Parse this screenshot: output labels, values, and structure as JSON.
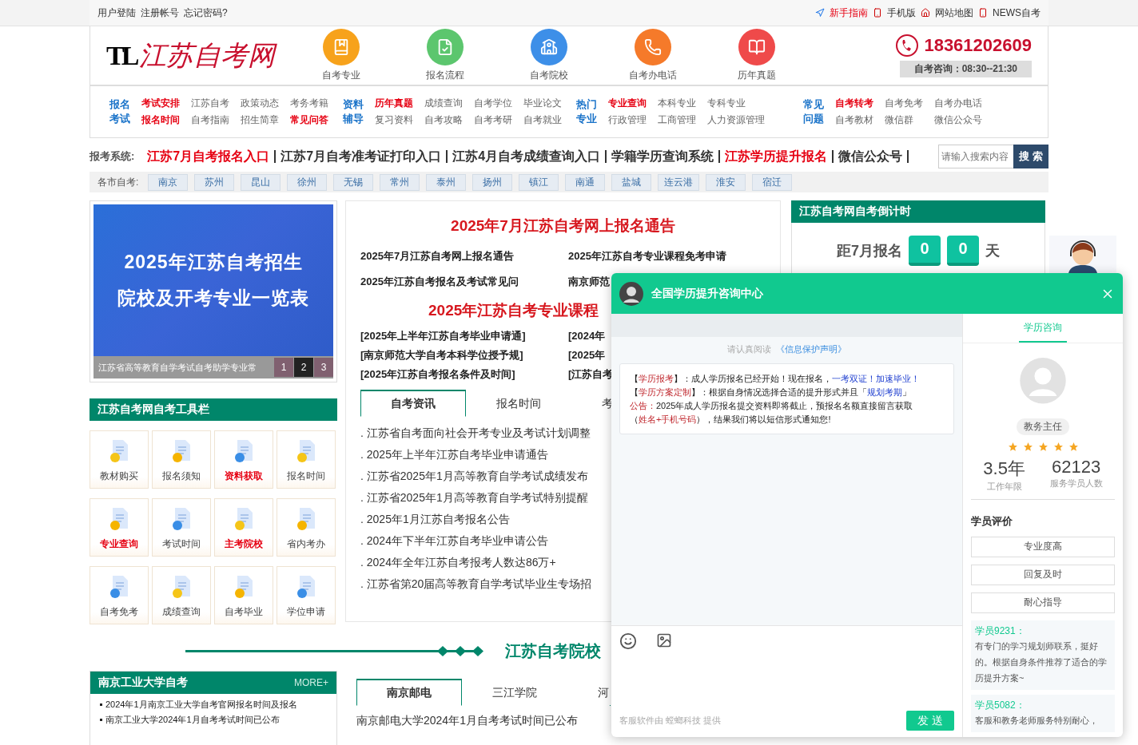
{
  "top_bar": {
    "left_links": [
      "用户登陆",
      "注册帐号",
      "忘记密码?"
    ],
    "right_links": [
      {
        "label": "新手指南",
        "highlighted": true
      },
      {
        "label": "手机版",
        "highlighted": false
      },
      {
        "label": "网站地图",
        "highlighted": false
      },
      {
        "label": "NEWS自考",
        "highlighted": false
      }
    ]
  },
  "header": {
    "logo_mark": "TL",
    "logo_text": "江苏自考网",
    "nav_icons": [
      {
        "label": "自考专业",
        "color": "#f7a21b"
      },
      {
        "label": "报名流程",
        "color": "#5cc66e"
      },
      {
        "label": "自考院校",
        "color": "#3d8fe8"
      },
      {
        "label": "自考办电话",
        "color": "#f57a2a"
      },
      {
        "label": "历年真题",
        "color": "#ef4a4a"
      }
    ],
    "phone": "18361202609",
    "hours": "自考咨询：08:30--21:30"
  },
  "nav_groups": [
    {
      "title_lines": [
        "报名",
        "考试"
      ],
      "rows": [
        [
          {
            "label": "考试安排",
            "highlighted": true
          },
          {
            "label": "江苏自考",
            "highlighted": false
          },
          {
            "label": "政策动态",
            "highlighted": false
          },
          {
            "label": "考务考籍",
            "highlighted": false
          }
        ],
        [
          {
            "label": "报名时间",
            "highlighted": true
          },
          {
            "label": "自考指南",
            "highlighted": false
          },
          {
            "label": "招生简章",
            "highlighted": false
          },
          {
            "label": "常见问答",
            "highlighted": true
          }
        ]
      ]
    },
    {
      "title_lines": [
        "资料",
        "辅导"
      ],
      "rows": [
        [
          {
            "label": "历年真题",
            "highlighted": true
          },
          {
            "label": "成绩查询",
            "highlighted": false
          },
          {
            "label": "自考学位",
            "highlighted": false
          },
          {
            "label": "毕业论文",
            "highlighted": false
          }
        ],
        [
          {
            "label": "复习资料",
            "highlighted": false
          },
          {
            "label": "自考攻略",
            "highlighted": false
          },
          {
            "label": "自考考研",
            "highlighted": false
          },
          {
            "label": "自考就业",
            "highlighted": false
          }
        ]
      ]
    },
    {
      "title_lines": [
        "热门",
        "专业"
      ],
      "rows": [
        [
          {
            "label": "专业查询",
            "highlighted": true
          },
          {
            "label": "本科专业",
            "highlighted": false
          },
          {
            "label": "专科专业",
            "highlighted": false
          }
        ],
        [
          {
            "label": "行政管理",
            "highlighted": false
          },
          {
            "label": "工商管理",
            "highlighted": false
          },
          {
            "label": "人力资源管理",
            "highlighted": false
          }
        ]
      ]
    },
    {
      "title_lines": [
        "常见",
        "问题"
      ],
      "rows": [
        [
          {
            "label": "自考转考",
            "highlighted": true
          },
          {
            "label": "自考免考",
            "highlighted": false
          },
          {
            "label": "自考办电话",
            "highlighted": false
          }
        ],
        [
          {
            "label": "自考教材",
            "highlighted": false
          },
          {
            "label": "微信群",
            "highlighted": false
          },
          {
            "label": "微信公众号",
            "highlighted": false
          }
        ]
      ]
    }
  ],
  "quick_links": {
    "label": "报考系统:",
    "links": [
      {
        "label": "江苏7月自考报名入口",
        "highlighted": true
      },
      {
        "label": "江苏7月自考准考证打印入口",
        "highlighted": false
      },
      {
        "label": "江苏4月自考成绩查询入口",
        "highlighted": false
      },
      {
        "label": "学籍学历查询系统",
        "highlighted": false
      },
      {
        "label": "江苏学历提升报名",
        "highlighted": true
      },
      {
        "label": "微信公众号",
        "highlighted": false
      }
    ],
    "search": {
      "placeholder": "请输入搜索内容",
      "button": "搜 索"
    }
  },
  "cities": {
    "label": "各市自考:",
    "items": [
      "南京",
      "苏州",
      "昆山",
      "徐州",
      "无锡",
      "常州",
      "泰州",
      "扬州",
      "镇江",
      "南通",
      "盐城",
      "连云港",
      "淮安",
      "宿迁"
    ]
  },
  "banner": {
    "title_lines": [
      "2025年江苏自考招生",
      "院校及开考专业一览表"
    ],
    "caption": "江苏省高等教育自学考试自考助学专业常",
    "pages": [
      {
        "label": "1",
        "selected": false
      },
      {
        "label": "2",
        "selected": true
      },
      {
        "label": "3",
        "selected": false
      }
    ]
  },
  "toolbar": {
    "title": "江苏自考网自考工具栏",
    "tools": [
      {
        "label": "教材购买",
        "highlighted": false
      },
      {
        "label": "报名须知",
        "highlighted": false
      },
      {
        "label": "资料获取",
        "highlighted": true
      },
      {
        "label": "报名时间",
        "highlighted": false
      },
      {
        "label": "专业查询",
        "highlighted": true
      },
      {
        "label": "考试时间",
        "highlighted": false
      },
      {
        "label": "主考院校",
        "highlighted": true
      },
      {
        "label": "省内考办",
        "highlighted": false
      },
      {
        "label": "自考免考",
        "highlighted": false
      },
      {
        "label": "成绩查询",
        "highlighted": false
      },
      {
        "label": "自考毕业",
        "highlighted": false
      },
      {
        "label": "学位申请",
        "highlighted": false
      }
    ]
  },
  "news": {
    "headline": "2025年7月江苏自考网上报名通告",
    "links": [
      "2025年7月江苏自考网上报名通告",
      "2025年江苏自考专业课程免考申请",
      "2025年江苏自考报名及考试常见问",
      "南京师范"
    ],
    "headline_2": "2025年江苏自考专业课程",
    "bracket_links": [
      "[2025年上半年江苏自考毕业申请通]",
      "[2024年",
      "[南京师范大学自考本科学位授予规]",
      "[2025年",
      "[2025年江苏自考报名条件及时间]",
      "[江苏自考"
    ],
    "tabs": [
      {
        "label": "自考资讯",
        "selected": true
      },
      {
        "label": "报名时间",
        "selected": false
      },
      {
        "label": "考",
        "selected": false
      }
    ],
    "items": [
      ". 江苏省自考面向社会开考专业及考试计划调整",
      ". 2025年上半年江苏自考毕业申请通告",
      ". 江苏省2025年1月高等教育自学考试成绩发布",
      ". 江苏省2025年1月高等教育自学考试特别提醒",
      ". 2025年1月江苏自考报名公告",
      ". 2024年下半年江苏自考毕业申请公告",
      ". 2024年全年江苏自考报考人数达86万+",
      ". 江苏省第20届高等教育自学考试毕业生专场招"
    ]
  },
  "countdown": {
    "title": "江苏自考网自考倒计时",
    "label": "距7月报名",
    "digits": [
      "0",
      "0"
    ],
    "unit": "天"
  },
  "schools_section": {
    "title": "江苏自考院校"
  },
  "university_card": {
    "title": "南京工业大学自考",
    "more": "MORE+",
    "items": [
      "2024年1月南京工业大学自考官网报名时间及报名",
      "南京工业大学2024年1月自考考试时间已公布"
    ]
  },
  "school_tabs": {
    "tabs": [
      {
        "label": "南京邮电",
        "selected": true
      },
      {
        "label": "三江学院",
        "selected": false
      },
      {
        "label": "河",
        "selected": false
      }
    ],
    "items": [
      "南京邮电大学2024年1月自考考试时间已公布"
    ]
  },
  "chat": {
    "title": "全国学历提升咨询中心",
    "notice": "请认真阅读",
    "notice_link": "《信息保护声明》",
    "message_lines": [
      [
        {
          "text": "【",
          "kind": "plain"
        },
        {
          "text": "学历报考",
          "kind": "red"
        },
        {
          "text": "】：成人学历报名已经开始！现在报名，",
          "kind": "plain"
        },
        {
          "text": "一考双证！加速毕业！",
          "kind": "blue"
        }
      ],
      [
        {
          "text": "【",
          "kind": "plain"
        },
        {
          "text": "学历方案定制",
          "kind": "red"
        },
        {
          "text": "】：根据自身情况选择合适的提升形式并且「",
          "kind": "plain"
        },
        {
          "text": "规划考期",
          "kind": "blue"
        },
        {
          "text": "」",
          "kind": "plain"
        }
      ],
      [
        {
          "text": "公告：",
          "kind": "red"
        },
        {
          "text": "2025年成人学历报名提交资料即将截止，预报名名额直接留言获取",
          "kind": "plain"
        }
      ],
      [
        {
          "text": "（",
          "kind": "plain"
        },
        {
          "text": "姓名+手机号码",
          "kind": "red"
        },
        {
          "text": "），结果我们将以短信形式通知您!",
          "kind": "plain"
        }
      ]
    ],
    "footer": "客服软件由 螳螂科技 提供",
    "send": "发 送",
    "side": {
      "tabs": [
        {
          "label": "学历咨询",
          "selected": true
        }
      ],
      "role": "教务主任",
      "stars": 5,
      "stats": [
        {
          "value": "3.5年",
          "label": "工作年限"
        },
        {
          "value": "62123",
          "label": "服务学员人数"
        }
      ],
      "reviews_title": "学员评价",
      "tags": [
        "专业度高",
        "回复及时",
        "耐心指导"
      ],
      "reviews": [
        {
          "name": "学员9231：",
          "text": "有专门的学习规划师联系，挺好的。根据自身条件推荐了适合的学历提升方案~"
        },
        {
          "name": "学员5082：",
          "text": "客服和教务老师服务特别耐心，"
        }
      ]
    }
  }
}
